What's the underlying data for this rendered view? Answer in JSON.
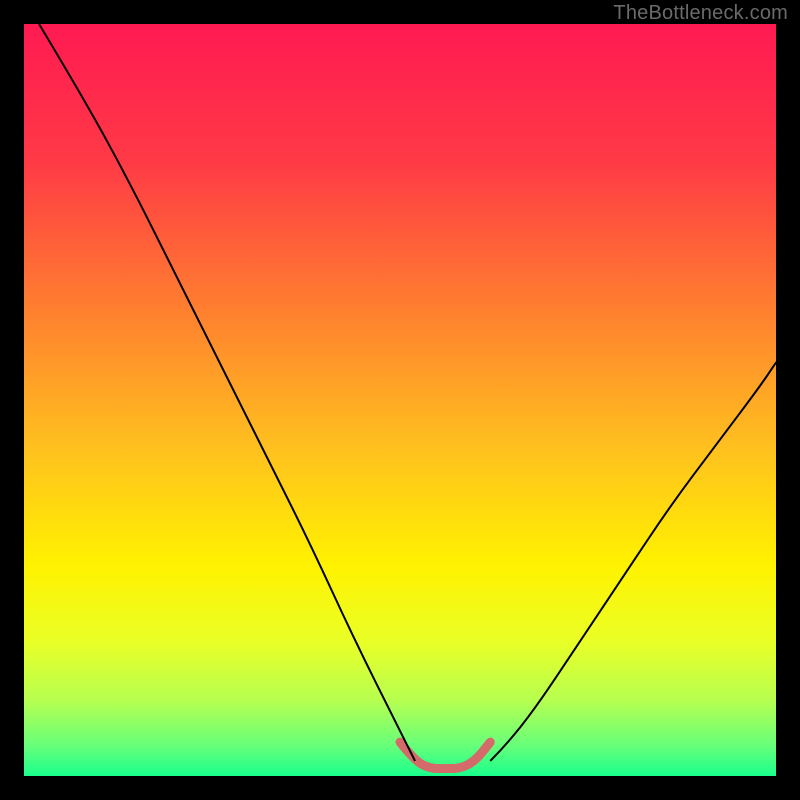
{
  "watermark": "TheBottleneck.com",
  "chart_data": {
    "type": "line",
    "title": "",
    "xlabel": "",
    "ylabel": "",
    "xlim": [
      0,
      100
    ],
    "ylim": [
      0,
      100
    ],
    "grid": false,
    "legend": false,
    "series": [
      {
        "name": "left-curve",
        "x": [
          2,
          8,
          14,
          20,
          26,
          32,
          38,
          44,
          50,
          52
        ],
        "values": [
          100,
          90,
          79,
          67,
          55,
          43,
          31,
          18,
          6,
          2
        ]
      },
      {
        "name": "right-curve",
        "x": [
          62,
          64,
          68,
          74,
          80,
          86,
          92,
          98,
          100
        ],
        "values": [
          2,
          4,
          9,
          18,
          27,
          36,
          44,
          52,
          55
        ]
      },
      {
        "name": "highlight-band",
        "x": [
          50,
          52,
          54,
          56,
          58,
          60,
          62
        ],
        "values": [
          4.5,
          2,
          1,
          1,
          1,
          2,
          4.5
        ]
      }
    ],
    "gradient_stops": [
      {
        "offset": 0,
        "color": "#ff1a52"
      },
      {
        "offset": 0.18,
        "color": "#ff3946"
      },
      {
        "offset": 0.38,
        "color": "#ff7f2f"
      },
      {
        "offset": 0.56,
        "color": "#ffbf1f"
      },
      {
        "offset": 0.72,
        "color": "#fff200"
      },
      {
        "offset": 0.82,
        "color": "#eaff26"
      },
      {
        "offset": 0.9,
        "color": "#b6ff50"
      },
      {
        "offset": 0.96,
        "color": "#66ff7a"
      },
      {
        "offset": 1.0,
        "color": "#19ff8c"
      }
    ],
    "highlight_style": {
      "color": "#d46a6a",
      "width": 9,
      "linecap": "round"
    },
    "curve_style": {
      "color": "#000000",
      "width": 2
    }
  }
}
